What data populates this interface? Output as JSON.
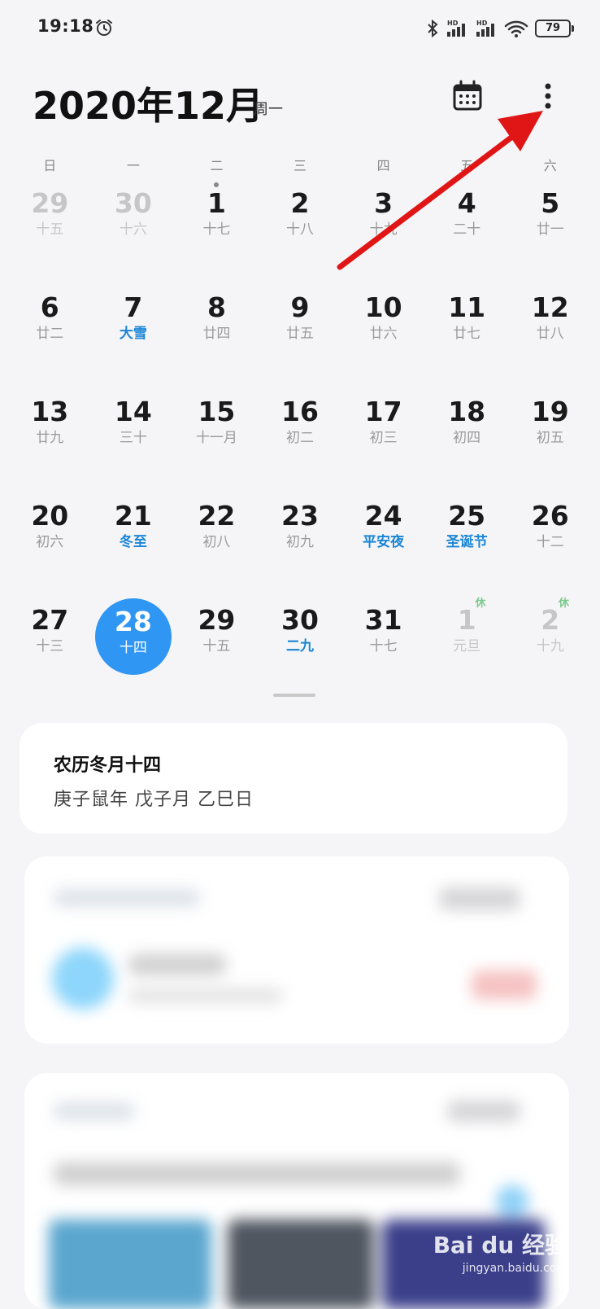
{
  "status_bar": {
    "time": "19:18",
    "battery": "79",
    "icons": [
      "alarm-icon",
      "bluetooth-icon",
      "signal-hd-icon",
      "signal-hd-icon",
      "wifi-icon",
      "battery-icon"
    ]
  },
  "header": {
    "month_title": "2020年12月",
    "weekday": "周一",
    "calendar_icon": "calendar-icon",
    "more_icon": "more-vertical-icon"
  },
  "weekdays": [
    "日",
    "一",
    "二",
    "三",
    "四",
    "五",
    "六"
  ],
  "weeks": [
    [
      {
        "num": "29",
        "lunar": "十五",
        "other": true
      },
      {
        "num": "30",
        "lunar": "十六",
        "other": true
      },
      {
        "num": "1",
        "lunar": "十七",
        "dot": true
      },
      {
        "num": "2",
        "lunar": "十八"
      },
      {
        "num": "3",
        "lunar": "十九"
      },
      {
        "num": "4",
        "lunar": "二十"
      },
      {
        "num": "5",
        "lunar": "廿一"
      }
    ],
    [
      {
        "num": "6",
        "lunar": "廿二"
      },
      {
        "num": "7",
        "lunar": "大雪",
        "festival": true
      },
      {
        "num": "8",
        "lunar": "廿四"
      },
      {
        "num": "9",
        "lunar": "廿五"
      },
      {
        "num": "10",
        "lunar": "廿六"
      },
      {
        "num": "11",
        "lunar": "廿七"
      },
      {
        "num": "12",
        "lunar": "廿八"
      }
    ],
    [
      {
        "num": "13",
        "lunar": "廿九"
      },
      {
        "num": "14",
        "lunar": "三十"
      },
      {
        "num": "15",
        "lunar": "十一月"
      },
      {
        "num": "16",
        "lunar": "初二"
      },
      {
        "num": "17",
        "lunar": "初三"
      },
      {
        "num": "18",
        "lunar": "初四"
      },
      {
        "num": "19",
        "lunar": "初五"
      }
    ],
    [
      {
        "num": "20",
        "lunar": "初六"
      },
      {
        "num": "21",
        "lunar": "冬至",
        "festival": true
      },
      {
        "num": "22",
        "lunar": "初八"
      },
      {
        "num": "23",
        "lunar": "初九"
      },
      {
        "num": "24",
        "lunar": "平安夜",
        "festival": true
      },
      {
        "num": "25",
        "lunar": "圣诞节",
        "festival": true
      },
      {
        "num": "26",
        "lunar": "十二"
      }
    ],
    [
      {
        "num": "27",
        "lunar": "十三"
      },
      {
        "num": "28",
        "lunar": "十四",
        "selected": true
      },
      {
        "num": "29",
        "lunar": "十五"
      },
      {
        "num": "30",
        "lunar": "二九",
        "festival": true
      },
      {
        "num": "31",
        "lunar": "十七"
      },
      {
        "num": "1",
        "lunar": "元旦",
        "other": true,
        "rest": "休"
      },
      {
        "num": "2",
        "lunar": "十九",
        "other": true,
        "rest": "休"
      }
    ]
  ],
  "lunar_card": {
    "title": "农历冬月十四",
    "subtitle": "庚子鼠年 戊子月 乙巳日"
  },
  "colors": {
    "accent": "#2f96f3",
    "festival": "#1a86d6",
    "rest": "#7ac98a",
    "arrow": "#e01515"
  },
  "watermark": {
    "brand": "Bai du 经验",
    "url": "jingyan.baidu.com"
  }
}
